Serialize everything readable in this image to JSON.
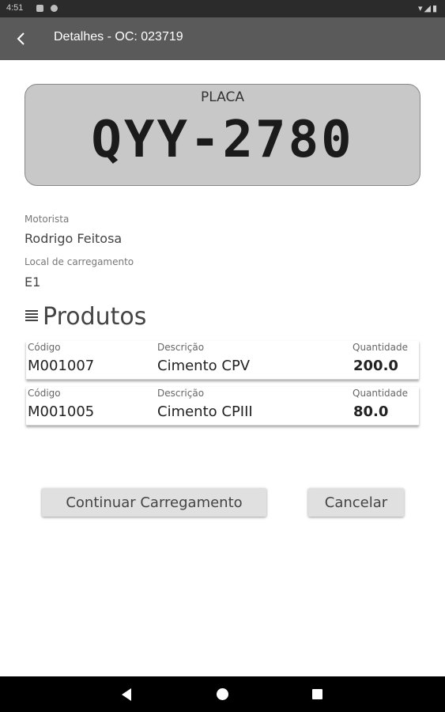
{
  "status_bar": {
    "time": "4:51"
  },
  "app_bar": {
    "title": "Detalhes - OC: 023719"
  },
  "plate": {
    "label": "PLACA",
    "number": "QYY-2780"
  },
  "driver": {
    "label": "Motorista",
    "value": "Rodrigo Feitosa"
  },
  "loading_place": {
    "label": "Local de carregamento",
    "value": "E1"
  },
  "products_section": {
    "title": "Produtos"
  },
  "product_headers": {
    "code": "Código",
    "description": "Descrição",
    "quantity": "Quantidade"
  },
  "products": [
    {
      "code": "M001007",
      "description": "Cimento CPV",
      "quantity": "200.0"
    },
    {
      "code": "M001005",
      "description": "Cimento CPIII",
      "quantity": "80.0"
    }
  ],
  "buttons": {
    "continue": "Continuar Carregamento",
    "cancel": "Cancelar"
  },
  "colors": {
    "app_bar": "#5a5a5a",
    "status_bar": "#2b2b2b",
    "plate_bg": "#c8c8c8",
    "button_bg": "#e0e0e0"
  }
}
